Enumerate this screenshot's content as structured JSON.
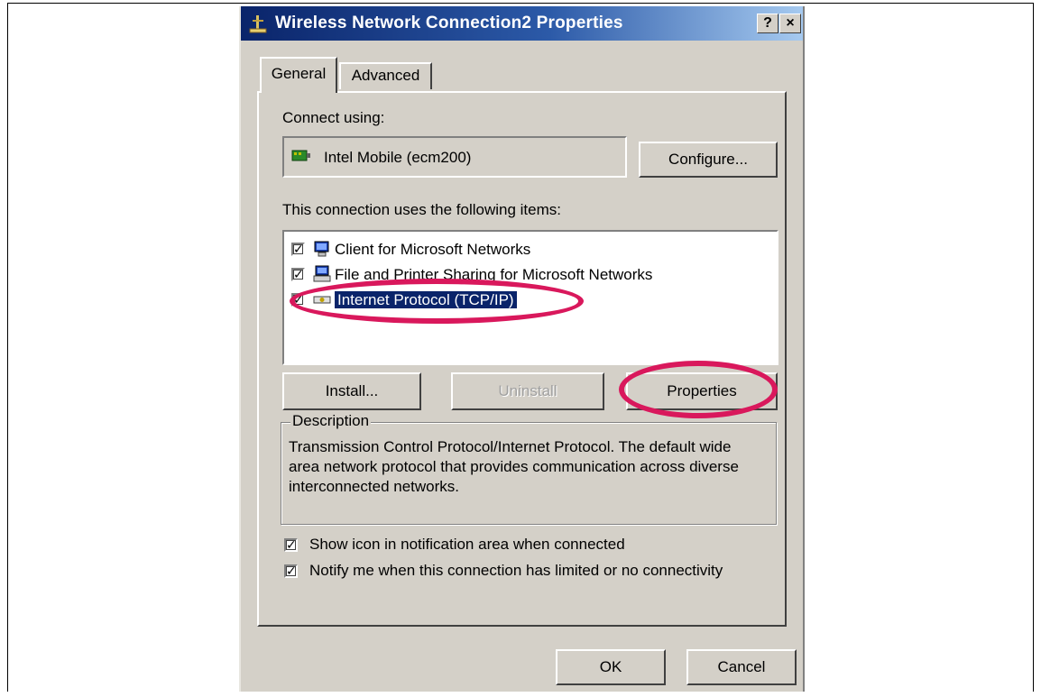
{
  "window": {
    "title": "Wireless Network Connection2 Properties",
    "help_label": "?",
    "close_label": "×"
  },
  "tabs": [
    {
      "label": "General",
      "active": true
    },
    {
      "label": "Advanced",
      "active": false
    }
  ],
  "general": {
    "connect_using_label": "Connect using:",
    "adapter_name": "Intel Mobile (ecm200)",
    "configure_button": "Configure...",
    "items_label": "This connection uses the following items:",
    "items": [
      {
        "label": "Client for Microsoft Networks",
        "checked": true,
        "icon": "network-client-icon"
      },
      {
        "label": "File and Printer Sharing for Microsoft Networks",
        "checked": true,
        "icon": "file-printer-sharing-icon"
      },
      {
        "label": "Internet Protocol (TCP/IP)",
        "checked": true,
        "selected": true,
        "icon": "protocol-icon"
      }
    ],
    "install_button": "Install...",
    "uninstall_button": "Uninstall",
    "properties_button": "Properties",
    "description_legend": "Description",
    "description_text": "Transmission Control Protocol/Internet Protocol. The default wide area network protocol that provides communication across diverse interconnected networks.",
    "show_icon_label": "Show icon in notification area when connected",
    "show_icon_checked": true,
    "notify_label": "Notify me when this connection has limited or no connectivity",
    "notify_checked": true
  },
  "footer": {
    "ok_button": "OK",
    "cancel_button": "Cancel"
  },
  "colors": {
    "highlight_annotation": "#d9185c",
    "dialog_face": "#d4d0c8",
    "titlebar": "#0a246a",
    "selection": "#0a246a"
  }
}
